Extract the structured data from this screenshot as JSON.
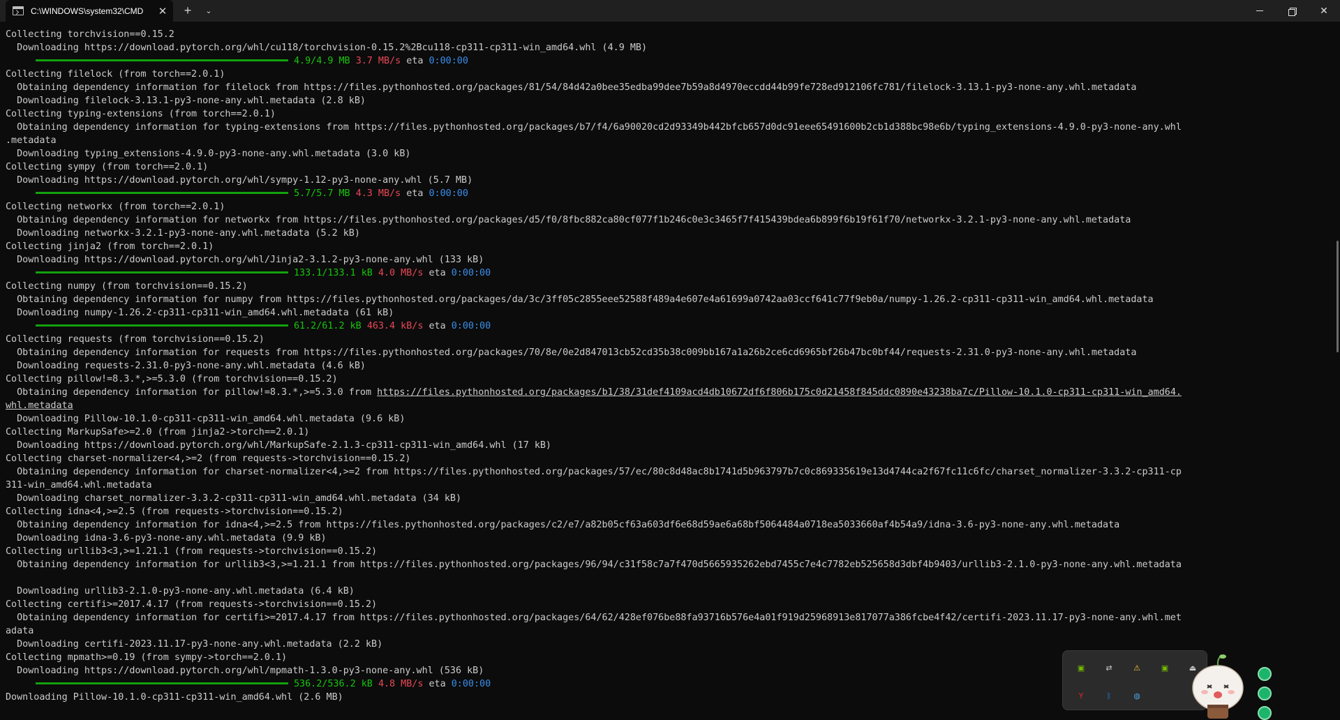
{
  "window": {
    "tab_title": "C:\\WINDOWS\\system32\\CMD",
    "icons": {
      "tab": "terminal-icon",
      "close": "close-icon",
      "new_tab": "plus-icon",
      "dropdown": "chevron-down-icon",
      "minimize": "minimize-icon",
      "maximize": "restore-icon",
      "window_close": "close-icon"
    },
    "glyphs": {
      "close": "✕",
      "new_tab": "+",
      "dropdown": "⌄",
      "window_close": "✕"
    }
  },
  "terminal": {
    "colors": {
      "background": "#0c0c0c",
      "text": "#cccccc",
      "progress": "#16c60c",
      "speed": "#e74856",
      "eta": "#3b8eea"
    },
    "lines": [
      {
        "type": "text",
        "text": "Collecting torchvision==0.15.2"
      },
      {
        "type": "text",
        "text": "  Downloading https://download.pytorch.org/whl/cu118/torchvision-0.15.2%2Bcu118-cp311-cp311-win_amd64.whl (4.9 MB)"
      },
      {
        "type": "progress",
        "size": "4.9/4.9 MB",
        "speed": "3.7 MB/s",
        "eta_label": "eta",
        "eta": "0:00:00",
        "fraction": 1.0
      },
      {
        "type": "text",
        "text": "Collecting filelock (from torch==2.0.1)"
      },
      {
        "type": "text",
        "text": "  Obtaining dependency information for filelock from https://files.pythonhosted.org/packages/81/54/84d42a0bee35edba99dee7b59a8d4970eccdd44b99fe728ed912106fc781/filelock-3.13.1-py3-none-any.whl.metadata"
      },
      {
        "type": "text",
        "text": "  Downloading filelock-3.13.1-py3-none-any.whl.metadata (2.8 kB)"
      },
      {
        "type": "text",
        "text": "Collecting typing-extensions (from torch==2.0.1)"
      },
      {
        "type": "text",
        "text": "  Obtaining dependency information for typing-extensions from https://files.pythonhosted.org/packages/b7/f4/6a90020cd2d93349b442bfcb657d0dc91eee65491600b2cb1d388bc98e6b/typing_extensions-4.9.0-py3-none-any.whl"
      },
      {
        "type": "text",
        "text": ".metadata"
      },
      {
        "type": "text",
        "text": "  Downloading typing_extensions-4.9.0-py3-none-any.whl.metadata (3.0 kB)"
      },
      {
        "type": "text",
        "text": "Collecting sympy (from torch==2.0.1)"
      },
      {
        "type": "text",
        "text": "  Downloading https://download.pytorch.org/whl/sympy-1.12-py3-none-any.whl (5.7 MB)"
      },
      {
        "type": "progress",
        "size": "5.7/5.7 MB",
        "speed": "4.3 MB/s",
        "eta_label": "eta",
        "eta": "0:00:00",
        "fraction": 1.0
      },
      {
        "type": "text",
        "text": "Collecting networkx (from torch==2.0.1)"
      },
      {
        "type": "text",
        "text": "  Obtaining dependency information for networkx from https://files.pythonhosted.org/packages/d5/f0/8fbc882ca80cf077f1b246c0e3c3465f7f415439bdea6b899f6b19f61f70/networkx-3.2.1-py3-none-any.whl.metadata"
      },
      {
        "type": "text",
        "text": "  Downloading networkx-3.2.1-py3-none-any.whl.metadata (5.2 kB)"
      },
      {
        "type": "text",
        "text": "Collecting jinja2 (from torch==2.0.1)"
      },
      {
        "type": "text",
        "text": "  Downloading https://download.pytorch.org/whl/Jinja2-3.1.2-py3-none-any.whl (133 kB)"
      },
      {
        "type": "progress",
        "size": "133.1/133.1 kB",
        "speed": "4.0 MB/s",
        "eta_label": "eta",
        "eta": "0:00:00",
        "fraction": 1.0
      },
      {
        "type": "text",
        "text": "Collecting numpy (from torchvision==0.15.2)"
      },
      {
        "type": "text",
        "text": "  Obtaining dependency information for numpy from https://files.pythonhosted.org/packages/da/3c/3ff05c2855eee52588f489a4e607e4a61699a0742aa03ccf641c77f9eb0a/numpy-1.26.2-cp311-cp311-win_amd64.whl.metadata"
      },
      {
        "type": "text",
        "text": "  Downloading numpy-1.26.2-cp311-cp311-win_amd64.whl.metadata (61 kB)"
      },
      {
        "type": "progress",
        "size": "61.2/61.2 kB",
        "speed": "463.4 kB/s",
        "eta_label": "eta",
        "eta": "0:00:00",
        "fraction": 1.0
      },
      {
        "type": "text",
        "text": "Collecting requests (from torchvision==0.15.2)"
      },
      {
        "type": "text",
        "text": "  Obtaining dependency information for requests from https://files.pythonhosted.org/packages/70/8e/0e2d847013cb52cd35b38c009bb167a1a26b2ce6cd6965bf26b47bc0bf44/requests-2.31.0-py3-none-any.whl.metadata"
      },
      {
        "type": "text",
        "text": "  Downloading requests-2.31.0-py3-none-any.whl.metadata (4.6 kB)"
      },
      {
        "type": "text",
        "text": "Collecting pillow!=8.3.*,>=5.3.0 (from torchvision==0.15.2)"
      },
      {
        "type": "link",
        "prefix": "  Obtaining dependency information for pillow!=8.3.*,>=5.3.0 from ",
        "link": "https://files.pythonhosted.org/packages/b1/38/31def4109acd4db10672df6f806b175c0d21458f845ddc0890e43238ba7c/Pillow-10.1.0-cp311-cp311-win_amd64."
      },
      {
        "type": "link",
        "prefix": "",
        "link": "whl.metadata"
      },
      {
        "type": "text",
        "text": "  Downloading Pillow-10.1.0-cp311-cp311-win_amd64.whl.metadata (9.6 kB)"
      },
      {
        "type": "text",
        "text": "Collecting MarkupSafe>=2.0 (from jinja2->torch==2.0.1)"
      },
      {
        "type": "text",
        "text": "  Downloading https://download.pytorch.org/whl/MarkupSafe-2.1.3-cp311-cp311-win_amd64.whl (17 kB)"
      },
      {
        "type": "text",
        "text": "Collecting charset-normalizer<4,>=2 (from requests->torchvision==0.15.2)"
      },
      {
        "type": "text",
        "text": "  Obtaining dependency information for charset-normalizer<4,>=2 from https://files.pythonhosted.org/packages/57/ec/80c8d48ac8b1741d5b963797b7c0c869335619e13d4744ca2f67fc11c6fc/charset_normalizer-3.3.2-cp311-cp"
      },
      {
        "type": "text",
        "text": "311-win_amd64.whl.metadata"
      },
      {
        "type": "text",
        "text": "  Downloading charset_normalizer-3.3.2-cp311-cp311-win_amd64.whl.metadata (34 kB)"
      },
      {
        "type": "text",
        "text": "Collecting idna<4,>=2.5 (from requests->torchvision==0.15.2)"
      },
      {
        "type": "text",
        "text": "  Obtaining dependency information for idna<4,>=2.5 from https://files.pythonhosted.org/packages/c2/e7/a82b05cf63a603df6e68d59ae6a68bf5064484a0718ea5033660af4b54a9/idna-3.6-py3-none-any.whl.metadata"
      },
      {
        "type": "text",
        "text": "  Downloading idna-3.6-py3-none-any.whl.metadata (9.9 kB)"
      },
      {
        "type": "text",
        "text": "Collecting urllib3<3,>=1.21.1 (from requests->torchvision==0.15.2)"
      },
      {
        "type": "text",
        "text": "  Obtaining dependency information for urllib3<3,>=1.21.1 from https://files.pythonhosted.org/packages/96/94/c31f58c7a7f470d5665935262ebd7455c7e4c7782eb525658d3dbf4b9403/urllib3-2.1.0-py3-none-any.whl.metadata"
      },
      {
        "type": "text",
        "text": ""
      },
      {
        "type": "text",
        "text": "  Downloading urllib3-2.1.0-py3-none-any.whl.metadata (6.4 kB)"
      },
      {
        "type": "text",
        "text": "Collecting certifi>=2017.4.17 (from requests->torchvision==0.15.2)"
      },
      {
        "type": "text",
        "text": "  Obtaining dependency information for certifi>=2017.4.17 from https://files.pythonhosted.org/packages/64/62/428ef076be88fa93716b576e4a01f919d25968913e817077a386fcbe4f42/certifi-2023.11.17-py3-none-any.whl.met"
      },
      {
        "type": "text",
        "text": "adata"
      },
      {
        "type": "text",
        "text": "  Downloading certifi-2023.11.17-py3-none-any.whl.metadata (2.2 kB)"
      },
      {
        "type": "text",
        "text": "Collecting mpmath>=0.19 (from sympy->torch==2.0.1)"
      },
      {
        "type": "text",
        "text": "  Downloading https://download.pytorch.org/whl/mpmath-1.3.0-py3-none-any.whl (536 kB)"
      },
      {
        "type": "progress",
        "size": "536.2/536.2 kB",
        "speed": "4.8 MB/s",
        "eta_label": "eta",
        "eta": "0:00:00",
        "fraction": 1.0
      },
      {
        "type": "text",
        "text": "Downloading Pillow-10.1.0-cp311-cp311-win_amd64.whl (2.6 MB)"
      }
    ]
  },
  "tray": {
    "icons": [
      "nvidia-icon",
      "network-settings-icon",
      "windows-security-warning-icon",
      "nvidia-broadcast-icon",
      "usb-eject-icon",
      "youdao-dictionary-icon",
      "bluetooth-icon",
      "network-globe-icon"
    ],
    "glyphs": [
      "▣",
      "⇄",
      "⚠",
      "▣",
      "⏏",
      "Y",
      "ᛒ",
      "◍"
    ],
    "colors": [
      "#76b900",
      "#d0d0d0",
      "#f3c33c",
      "#76b900",
      "#d0d0d0",
      "#e0252b",
      "#1e88e5",
      "#4aa3df"
    ],
    "side_icons": [
      "wechat-icon",
      "wechat-icon",
      "wechat-icon"
    ]
  }
}
